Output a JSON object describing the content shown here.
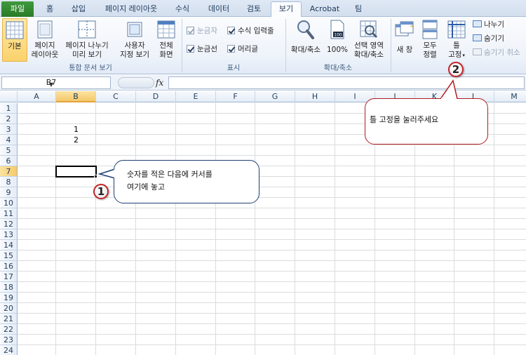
{
  "tabs": [
    "파일",
    "홈",
    "삽입",
    "페이지 레이아웃",
    "수식",
    "데이터",
    "검토",
    "보기",
    "Acrobat",
    "팀"
  ],
  "ribbon": {
    "workbook_views": {
      "normal": "기본",
      "page_layout": [
        "페이지",
        "레이아웃"
      ],
      "page_break": [
        "페이지 나누기",
        "미리 보기"
      ],
      "custom": [
        "사용자",
        "지정 보기"
      ],
      "full_screen": [
        "전체",
        "화면"
      ],
      "group_label": "통합 문서 보기"
    },
    "show": {
      "ruler": "눈금자",
      "formula_bar": "수식 입력줄",
      "gridlines": "눈금선",
      "headings": "머리글",
      "group_label": "표시"
    },
    "zoom": {
      "zoom": "확대/축소",
      "hundred": "100%",
      "selection": [
        "선택 영역",
        "확대/축소"
      ],
      "group_label": "확대/축소"
    },
    "window": {
      "new_window": "새 창",
      "arrange_all": [
        "모두",
        "정렬"
      ],
      "freeze": [
        "틀",
        "고정"
      ],
      "split": "나누기",
      "hide": "숨기기",
      "unhide": "숨기기 취소"
    }
  },
  "formula_bar": {
    "name_box": "B7",
    "fx": "fx",
    "value": ""
  },
  "sheet": {
    "columns": [
      "A",
      "B",
      "C",
      "D",
      "E",
      "F",
      "G",
      "H",
      "I",
      "J",
      "K",
      "L",
      "M"
    ],
    "rows": [
      "1",
      "2",
      "3",
      "4",
      "5",
      "6",
      "7",
      "8",
      "9",
      "10",
      "11",
      "12",
      "13",
      "14",
      "15",
      "16",
      "17",
      "18",
      "19",
      "20",
      "21",
      "22",
      "23",
      "24"
    ],
    "cells": {
      "B3": "1",
      "B4": "2"
    },
    "active_cell": "B7"
  },
  "callouts": {
    "one": {
      "badge": "1",
      "text": [
        "숫자를 적은 다음에 커서를",
        "여기에 놓고"
      ]
    },
    "two": {
      "badge": "2",
      "text": "틀 고정을 눌러주세요"
    }
  },
  "colors": {
    "file_tab": "#2f8a2c",
    "selection": "#f5c96b",
    "callout_1_border": "#1f3f74",
    "callout_2_border": "#b01d22"
  }
}
